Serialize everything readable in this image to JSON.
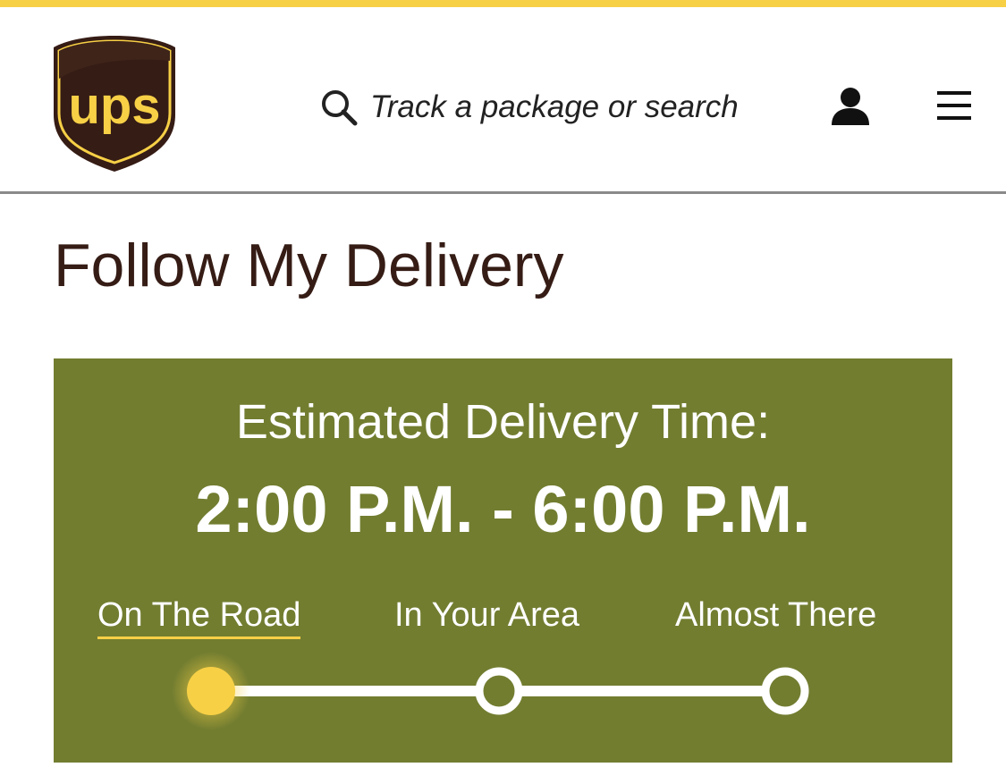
{
  "header": {
    "logo_alt": "UPS",
    "logo_text": "ups",
    "search_placeholder": "Track a package or search"
  },
  "page": {
    "title": "Follow My Delivery"
  },
  "delivery": {
    "estimated_label": "Estimated Delivery Time:",
    "window": "2:00 P.M. - 6:00 P.M.",
    "steps": [
      {
        "label": "On The Road",
        "active": true
      },
      {
        "label": "In Your Area",
        "active": false
      },
      {
        "label": "Almost There",
        "active": false
      }
    ],
    "current_step": 1,
    "total_steps": 3
  },
  "colors": {
    "brand_brown": "#351c15",
    "brand_gold": "#f7d046",
    "panel_green": "#727d30"
  },
  "icons": {
    "search": "search-icon",
    "account": "account-icon",
    "menu": "hamburger-menu-icon"
  }
}
